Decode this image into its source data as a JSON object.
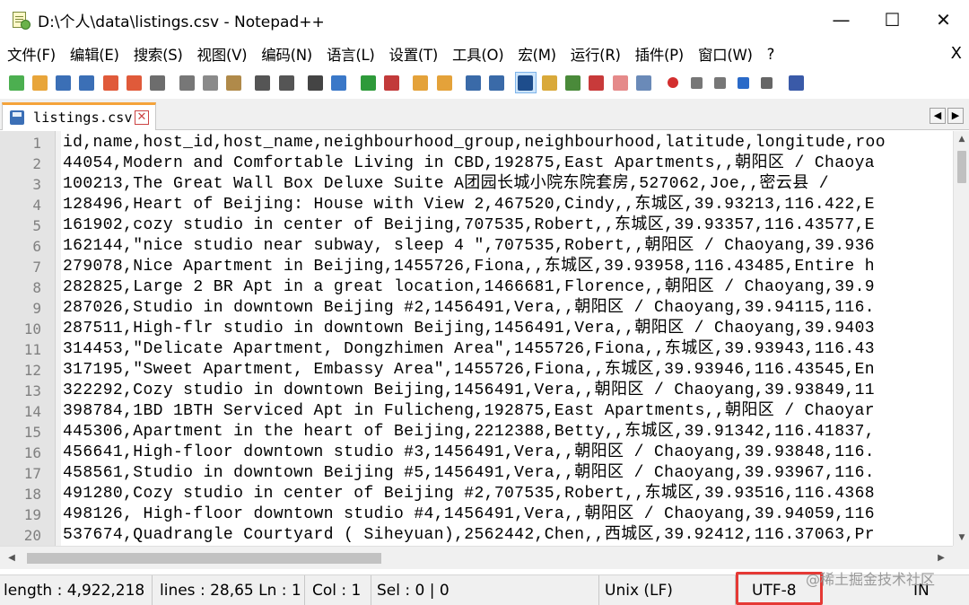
{
  "window": {
    "title": "D:\\个人\\data\\listings.csv - Notepad++",
    "minimize": "—",
    "maximize": "☐",
    "close": "✕"
  },
  "menu": {
    "items": [
      "文件(F)",
      "编辑(E)",
      "搜索(S)",
      "视图(V)",
      "编码(N)",
      "语言(L)",
      "设置(T)",
      "工具(O)",
      "宏(M)",
      "运行(R)",
      "插件(P)",
      "窗口(W)",
      "?"
    ],
    "close": "X"
  },
  "toolbar": {
    "icons": [
      "new-file-icon",
      "open-file-icon",
      "save-icon",
      "save-all-icon",
      "close-icon",
      "close-all-icon",
      "print-icon",
      "cut-icon",
      "copy-icon",
      "paste-icon",
      "undo-icon",
      "redo-icon",
      "find-icon",
      "replace-icon",
      "zoom-in-icon",
      "zoom-out-icon",
      "sync-vertical-icon",
      "sync-horizontal-icon",
      "word-wrap-icon",
      "show-all-chars-icon",
      "indent-guide-icon",
      "doc-map-icon",
      "function-list-icon",
      "folder-workspace-icon",
      "folder-icon",
      "monitor-icon",
      "record-macro-icon",
      "stop-record-icon",
      "play-macro-icon",
      "run-macro-multiple-icon",
      "save-macro-icon",
      "spell-check-icon"
    ],
    "colors": {
      "new-file-icon": "#4caf50",
      "open-file-icon": "#e8a53a",
      "save-icon": "#3b6fb6",
      "save-all-icon": "#3b6fb6",
      "close-icon": "#e05a3a",
      "close-all-icon": "#e05a3a",
      "print-icon": "#6d6d6d",
      "cut-icon": "#777777",
      "copy-icon": "#8a8a8a",
      "paste-icon": "#b08a4a",
      "undo-icon": "#555555",
      "redo-icon": "#555555",
      "find-icon": "#444444",
      "replace-icon": "#3a78c8",
      "zoom-in-icon": "#2e9a3a",
      "zoom-out-icon": "#c23a3a",
      "sync-vertical-icon": "#e4a23a",
      "sync-horizontal-icon": "#e4a23a",
      "word-wrap-icon": "#3a6aa8",
      "show-all-chars-icon": "#3a6aa8",
      "indent-guide-icon": "#1e4d8c",
      "doc-map-icon": "#d9a93a",
      "function-list-icon": "#4a8a3a",
      "folder-workspace-icon": "#c83a3a",
      "folder-icon": "#e58a8a",
      "monitor-icon": "#6a8ab8",
      "record-macro-icon": "#d32f2f",
      "stop-record-icon": "#777777",
      "play-macro-icon": "#777777",
      "run-macro-multiple-icon": "#2a6ac8",
      "save-macro-icon": "#666666",
      "spell-check-icon": "#3a5aa8"
    },
    "active": [
      "indent-guide-icon"
    ]
  },
  "tab": {
    "label": "listings.csv",
    "close": "✕",
    "scroll_left": "◀",
    "scroll_right": "▶"
  },
  "editor": {
    "lines": [
      {
        "num": "1",
        "text": "id,name,host_id,host_name,neighbourhood_group,neighbourhood,latitude,longitude,roo"
      },
      {
        "num": "2",
        "text": "44054,Modern and Comfortable Living in CBD,192875,East Apartments,,朝阳区 / Chaoya"
      },
      {
        "num": "3",
        "text": "100213,The Great Wall Box Deluxe Suite A团园长城小院东院套房,527062,Joe,,密云县 /"
      },
      {
        "num": "4",
        "text": "128496,Heart of Beijing: House with View 2,467520,Cindy,,东城区,39.93213,116.422,E"
      },
      {
        "num": "5",
        "text": "161902,cozy studio in center of Beijing,707535,Robert,,东城区,39.93357,116.43577,E"
      },
      {
        "num": "6",
        "text": "162144,\"nice studio near subway, sleep 4 \",707535,Robert,,朝阳区 / Chaoyang,39.936"
      },
      {
        "num": "7",
        "text": "279078,Nice Apartment in Beijing,1455726,Fiona,,东城区,39.93958,116.43485,Entire h"
      },
      {
        "num": "8",
        "text": "282825,Large 2 BR Apt in a great location,1466681,Florence,,朝阳区 / Chaoyang,39.9"
      },
      {
        "num": "9",
        "text": "287026,Studio in downtown Beijing #2,1456491,Vera,,朝阳区 / Chaoyang,39.94115,116."
      },
      {
        "num": "10",
        "text": "287511,High-flr studio in downtown Beijing,1456491,Vera,,朝阳区 / Chaoyang,39.9403"
      },
      {
        "num": "11",
        "text": "314453,\"Delicate Apartment, Dongzhimen Area\",1455726,Fiona,,东城区,39.93943,116.43"
      },
      {
        "num": "12",
        "text": "317195,\"Sweet Apartment, Embassy Area\",1455726,Fiona,,东城区,39.93946,116.43545,En"
      },
      {
        "num": "13",
        "text": "322292,Cozy studio in downtown Beijing,1456491,Vera,,朝阳区 / Chaoyang,39.93849,11"
      },
      {
        "num": "14",
        "text": "398784,1BD 1BTH Serviced Apt in Fulicheng,192875,East Apartments,,朝阳区 / Chaoyar"
      },
      {
        "num": "15",
        "text": "445306,Apartment in the heart of Beijing,2212388,Betty,,东城区,39.91342,116.41837,"
      },
      {
        "num": "16",
        "text": "456641,High-floor downtown studio #3,1456491,Vera,,朝阳区 / Chaoyang,39.93848,116."
      },
      {
        "num": "17",
        "text": "458561,Studio in downtown Beijing #5,1456491,Vera,,朝阳区 / Chaoyang,39.93967,116."
      },
      {
        "num": "18",
        "text": "491280,Cozy studio in center of Beijing #2,707535,Robert,,东城区,39.93516,116.4368"
      },
      {
        "num": "19",
        "text": "498126, High-floor downtown studio #4,1456491,Vera,,朝阳区 / Chaoyang,39.94059,116"
      },
      {
        "num": "20",
        "text": "537674,Quadrangle Courtyard ( Siheyuan),2562442,Chen,,西城区,39.92412,116.37063,Pr"
      }
    ]
  },
  "statusbar": {
    "length": "length : 4,922,218",
    "lines": "lines : 28,65  Ln : 1",
    "col": "Col : 1",
    "sel": "Sel : 0 | 0",
    "eol": "Unix (LF)",
    "encoding": "UTF-8",
    "mode": "IN"
  },
  "watermark": "@稀土掘金技术社区",
  "accent_colors": {
    "tab_top": "#f5a33a",
    "highlight_box": "#e53935",
    "current_line": "#e8e8ff"
  }
}
